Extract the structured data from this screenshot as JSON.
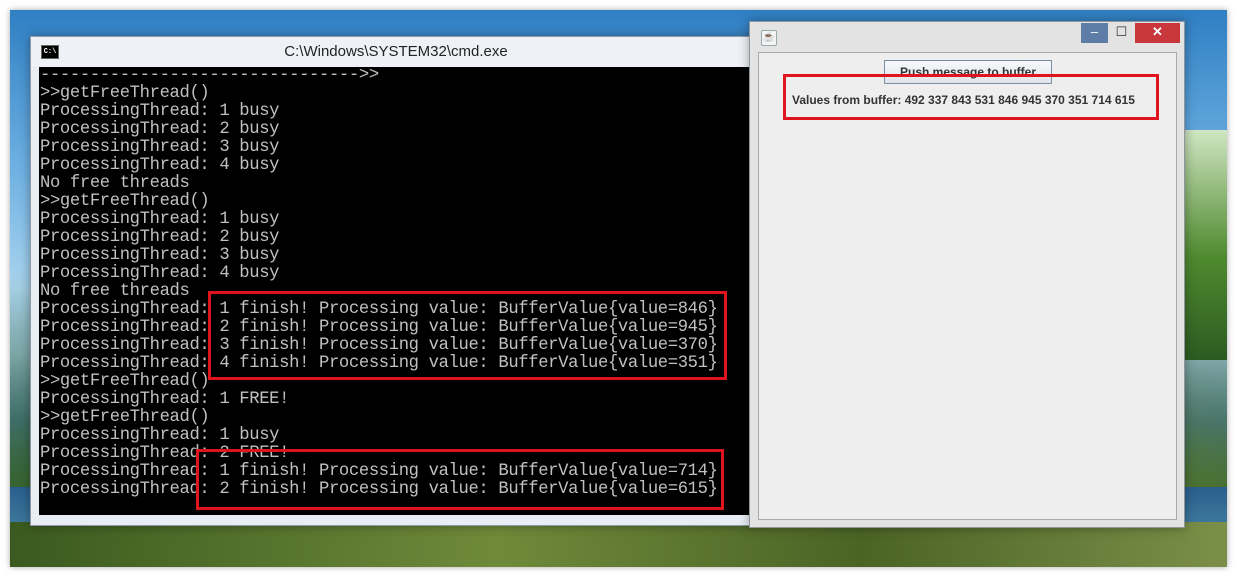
{
  "cmd": {
    "title": "C:\\Windows\\SYSTEM32\\cmd.exe",
    "icon_text": "C:\\",
    "lines": [
      "-------------------------------->>",
      ">>getFreeThread()",
      "ProcessingThread: 1 busy",
      "ProcessingThread: 2 busy",
      "ProcessingThread: 3 busy",
      "ProcessingThread: 4 busy",
      "No free threads",
      ">>getFreeThread()",
      "ProcessingThread: 1 busy",
      "ProcessingThread: 2 busy",
      "ProcessingThread: 3 busy",
      "ProcessingThread: 4 busy",
      "No free threads",
      "ProcessingThread: 1 finish! Processing value: BufferValue{value=846}",
      "ProcessingThread: 2 finish! Processing value: BufferValue{value=945}",
      "ProcessingThread: 3 finish! Processing value: BufferValue{value=370}",
      "ProcessingThread: 4 finish! Processing value: BufferValue{value=351}",
      ">>getFreeThread()",
      "ProcessingThread: 1 FREE!",
      ">>getFreeThread()",
      "ProcessingThread: 1 busy",
      "ProcessingThread: 2 FREE!",
      "ProcessingThread: 1 finish! Processing value: BufferValue{value=714}",
      "ProcessingThread: 2 finish! Processing value: BufferValue{value=615}"
    ]
  },
  "java": {
    "push_button_label": "Push message to buffer",
    "buffer_label": "Values from buffer: 492 337 843 531 846 945 370 351 714 615",
    "window_buttons": {
      "minimize": "–",
      "maximize": "☐",
      "close": "✕"
    }
  },
  "colors": {
    "highlight": "#e0141e",
    "console_text": "#c0c0c0",
    "console_bg": "#000000",
    "close_button": "#c7373b",
    "minimize_button": "#5d7da6"
  }
}
